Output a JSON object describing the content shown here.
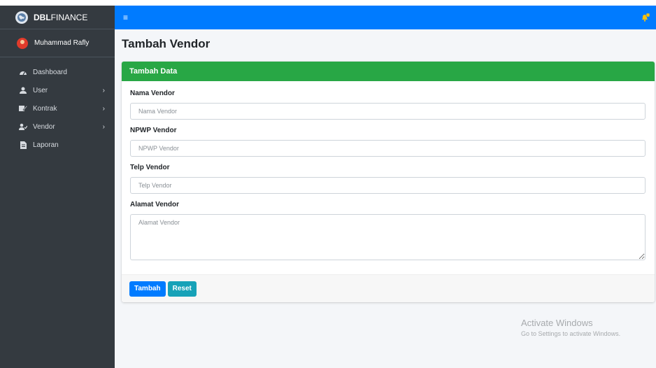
{
  "app": {
    "brand": "DBLFINANCE",
    "brand_bold": "DBL",
    "brand_rest": "FINANCE"
  },
  "user": {
    "name": "Muhammad Rafly"
  },
  "sidebar": {
    "items": [
      {
        "label": "Dashboard",
        "icon": "dashboard-icon",
        "has_children": false
      },
      {
        "label": "User",
        "icon": "user-icon",
        "has_children": true
      },
      {
        "label": "Kontrak",
        "icon": "contract-icon",
        "has_children": true
      },
      {
        "label": "Vendor",
        "icon": "vendor-icon",
        "has_children": true
      },
      {
        "label": "Laporan",
        "icon": "report-icon",
        "has_children": false
      }
    ]
  },
  "topbar": {
    "menu_icon": "hamburger-icon",
    "notification_icon": "bell-icon"
  },
  "page": {
    "title": "Tambah Vendor"
  },
  "form": {
    "header": "Tambah Data",
    "fields": {
      "nama": {
        "label": "Nama Vendor",
        "placeholder": "Nama Vendor",
        "value": ""
      },
      "npwp": {
        "label": "NPWP Vendor",
        "placeholder": "NPWP Vendor",
        "value": ""
      },
      "telp": {
        "label": "Telp Vendor",
        "placeholder": "Telp Vendor",
        "value": ""
      },
      "alamat": {
        "label": "Alamat Vendor",
        "placeholder": "Alamat Vendor",
        "value": ""
      }
    },
    "buttons": {
      "submit": "Tambah",
      "reset": "Reset"
    }
  },
  "watermark": {
    "title": "Activate Windows",
    "subtitle": "Go to Settings to activate Windows."
  },
  "colors": {
    "sidebar_bg": "#343a40",
    "topbar_bg": "#007bff",
    "card_header_bg": "#28a745",
    "btn_primary": "#007bff",
    "btn_info": "#17a2b8"
  }
}
